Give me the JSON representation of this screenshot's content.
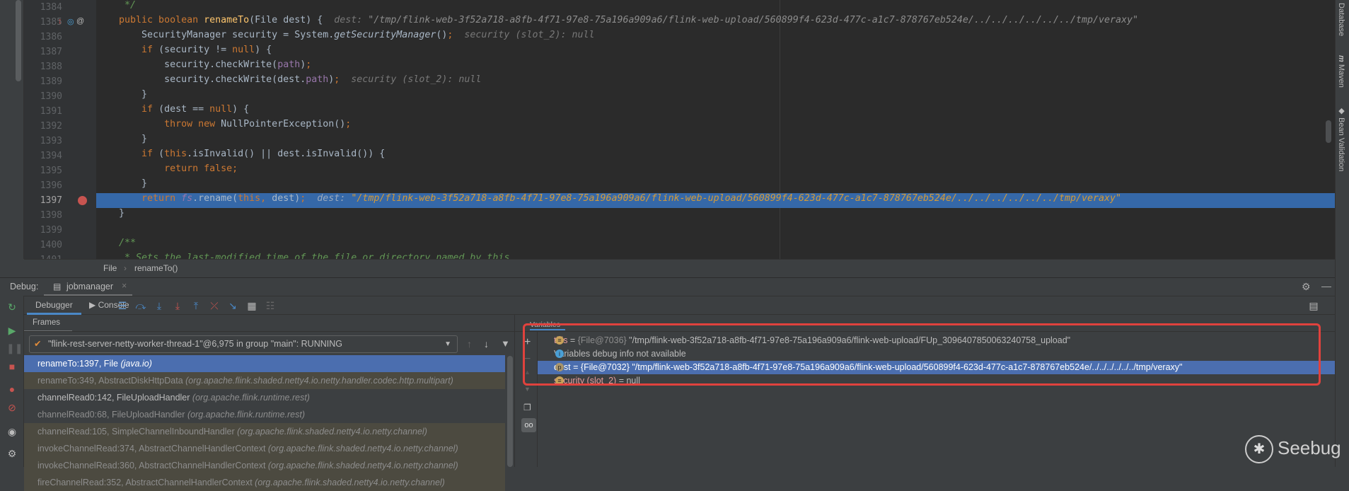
{
  "editor": {
    "lines": [
      {
        "n": "1384",
        "segs": [
          [
            "cm",
            "     */"
          ]
        ]
      },
      {
        "n": "1385",
        "segs": [
          [
            "kw",
            "    public boolean "
          ],
          [
            "fn",
            "renameTo"
          ],
          [
            "",
            "(File dest) {  "
          ],
          [
            "hint",
            "dest: "
          ],
          [
            "hintv",
            "\"/tmp/flink-web-3f52a718-a8fb-4f71-97e8-75a196a909a6/flink-web-upload/560899f4-623d-477c-a1c7-878767eb524e/../../../../../../tmp/veraxy\""
          ]
        ]
      },
      {
        "n": "1386",
        "segs": [
          [
            "",
            "        SecurityManager security = System."
          ],
          [
            "it",
            "getSecurityManager"
          ],
          [
            "",
            "()"
          ],
          [
            "kw",
            ";"
          ],
          [
            "",
            "  "
          ],
          [
            "hint",
            "security (slot_2): null"
          ]
        ]
      },
      {
        "n": "1387",
        "segs": [
          [
            "kw",
            "        if "
          ],
          [
            "",
            "(security != "
          ],
          [
            "kw",
            "null"
          ],
          [
            "",
            ") {"
          ]
        ]
      },
      {
        "n": "1388",
        "segs": [
          [
            "",
            "            security.checkWrite("
          ],
          [
            "fld",
            "path"
          ],
          [
            "",
            ")"
          ],
          [
            "kw",
            ";"
          ]
        ]
      },
      {
        "n": "1389",
        "segs": [
          [
            "",
            "            security.checkWrite(dest."
          ],
          [
            "fld",
            "path"
          ],
          [
            "",
            ")"
          ],
          [
            "kw",
            ";"
          ],
          [
            "",
            "  "
          ],
          [
            "hint",
            "security (slot_2): null"
          ]
        ]
      },
      {
        "n": "1390",
        "segs": [
          [
            "",
            "        }"
          ]
        ]
      },
      {
        "n": "1391",
        "segs": [
          [
            "kw",
            "        if "
          ],
          [
            "",
            "(dest == "
          ],
          [
            "kw",
            "null"
          ],
          [
            "",
            ") {"
          ]
        ]
      },
      {
        "n": "1392",
        "segs": [
          [
            "kw",
            "            throw new "
          ],
          [
            "",
            "NullPointerException()"
          ],
          [
            "kw",
            ";"
          ]
        ]
      },
      {
        "n": "1393",
        "segs": [
          [
            "",
            "        }"
          ]
        ]
      },
      {
        "n": "1394",
        "segs": [
          [
            "kw",
            "        if "
          ],
          [
            "",
            "("
          ],
          [
            "kw",
            "this"
          ],
          [
            "",
            ".isInvalid() || dest.isInvalid()) {"
          ]
        ]
      },
      {
        "n": "1395",
        "segs": [
          [
            "kw",
            "            return false;"
          ]
        ]
      },
      {
        "n": "1396",
        "segs": [
          [
            "",
            "        }"
          ]
        ]
      },
      {
        "n": "1397",
        "current": true,
        "segs": [
          [
            "kw",
            "        return "
          ],
          [
            "fld it",
            "fs"
          ],
          [
            "",
            ".rename("
          ],
          [
            "kw",
            "this, "
          ],
          [
            "",
            "dest)"
          ],
          [
            "kw",
            ";"
          ],
          [
            "",
            "  "
          ],
          [
            "hint",
            "dest: "
          ],
          [
            "hintv",
            "\"/tmp/flink-web-3f52a718-a8fb-4f71-97e8-75a196a909a6/flink-web-upload/560899f4-623d-477c-a1c7-878767eb524e/../../../../../../tmp/veraxy\""
          ]
        ]
      },
      {
        "n": "1398",
        "segs": [
          [
            "",
            "    }"
          ]
        ]
      },
      {
        "n": "1399",
        "segs": [
          [
            "",
            ""
          ]
        ]
      },
      {
        "n": "1400",
        "segs": [
          [
            "cm",
            "    /**"
          ]
        ]
      },
      {
        "n": "1401",
        "segs": [
          [
            "cm",
            "     * Sets the last-modified time of the file or directory named by this"
          ]
        ]
      }
    ]
  },
  "breadcrumb": {
    "items": [
      "File",
      "renameTo()"
    ]
  },
  "right_tools": [
    "Database",
    "Maven",
    "Bean Validation"
  ],
  "debug": {
    "label": "Debug:",
    "session_tab": "jobmanager",
    "tabs": {
      "debugger": "Debugger",
      "console": "Console"
    },
    "frames_header": "Frames",
    "variables_header": "Variables",
    "thread": "\"flink-rest-server-netty-worker-thread-1\"@6,975 in group \"main\": RUNNING",
    "frames": [
      {
        "method": "renameTo:1397, File",
        "pkg": "(java.io)",
        "style": "sel"
      },
      {
        "method": "renameTo:349, AbstractDiskHttpData",
        "pkg": "(org.apache.flink.shaded.netty4.io.netty.handler.codec.http.multipart)",
        "style": "lib"
      },
      {
        "method": "channelRead0:142, FileUploadHandler",
        "pkg": "(org.apache.flink.runtime.rest)",
        "style": "norm"
      },
      {
        "method": "channelRead0:68, FileUploadHandler",
        "pkg": "(org.apache.flink.runtime.rest)",
        "style": "dim"
      },
      {
        "method": "channelRead:105, SimpleChannelInboundHandler",
        "pkg": "(org.apache.flink.shaded.netty4.io.netty.channel)",
        "style": "lib"
      },
      {
        "method": "invokeChannelRead:374, AbstractChannelHandlerContext",
        "pkg": "(org.apache.flink.shaded.netty4.io.netty.channel)",
        "style": "lib"
      },
      {
        "method": "invokeChannelRead:360, AbstractChannelHandlerContext",
        "pkg": "(org.apache.flink.shaded.netty4.io.netty.channel)",
        "style": "lib"
      },
      {
        "method": "fireChannelRead:352, AbstractChannelHandlerContext",
        "pkg": "(org.apache.flink.shaded.netty4.io.netty.channel)",
        "style": "lib"
      }
    ],
    "variables": [
      {
        "icon": "field-icon",
        "name": "this",
        "eq": " = ",
        "type": "{File@7036}",
        "value": " \"/tmp/flink-web-3f52a718-a8fb-4f71-97e8-75a196a909a6/flink-web-upload/FUp_3096407850063240758_upload\""
      },
      {
        "icon": "info-icon",
        "name": "",
        "eq": "",
        "type": "",
        "value": "Variables debug info not available"
      },
      {
        "icon": "parameter-icon",
        "name": "dest",
        "eq": " = ",
        "type": "{File@7032}",
        "value": " \"/tmp/flink-web-3f52a718-a8fb-4f71-97e8-75a196a909a6/flink-web-upload/560899f4-623d-477c-a1c7-878767eb524e/../../../../../../tmp/veraxy\"",
        "selected": true
      },
      {
        "icon": "field-icon",
        "name": "security (slot_2)",
        "eq": " = ",
        "type": "",
        "value": "null"
      }
    ]
  },
  "watermark": "Seebug",
  "colors": {
    "accent": "#4b6eaf",
    "highlight_box": "#e0423d",
    "breakpoint": "#c75450"
  }
}
